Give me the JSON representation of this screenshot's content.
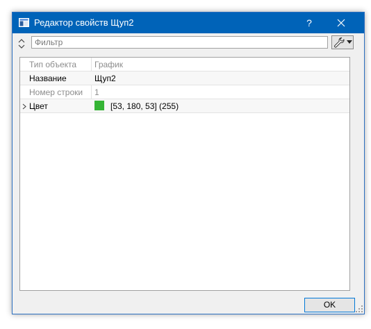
{
  "window": {
    "title": "Редактор свойств Щуп2",
    "help_label": "?",
    "close_label": "✕",
    "accent_color": "#0063b8"
  },
  "toolbar": {
    "filter_placeholder": "Фильтр",
    "filter_value": "",
    "icons": [
      "updown-icon",
      "wrench-icon",
      "dropdown-arrow-icon"
    ]
  },
  "properties": [
    {
      "name": "Тип объекта",
      "value": "График",
      "enabled": false
    },
    {
      "name": "Название",
      "value": "Щуп2",
      "enabled": true
    },
    {
      "name": "Номер строки",
      "value": "1",
      "enabled": false
    },
    {
      "name": "Цвет",
      "value": "[53, 180, 53] (255)",
      "enabled": true,
      "expandable": true,
      "swatch_color": "#35b435"
    }
  ],
  "buttons": {
    "ok_label": "OK"
  }
}
